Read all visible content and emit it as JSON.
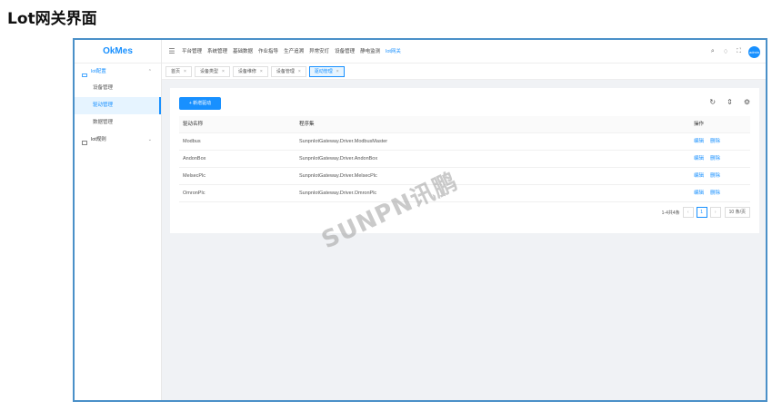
{
  "page_heading": "Lot网关界面",
  "app": {
    "logo": "OkMes"
  },
  "sidebar": {
    "groups": [
      {
        "label": "lot配置",
        "items": [
          "设备管理",
          "驱动管理",
          "数据管理"
        ]
      },
      {
        "label": "lot规则",
        "items": []
      }
    ],
    "active_item": "驱动管理"
  },
  "topnav": {
    "items": [
      "平台管理",
      "系统管理",
      "基础数据",
      "作业指导",
      "生产追溯",
      "异常安灯",
      "设备管理",
      "静电监测",
      "lot网关"
    ],
    "active": "lot网关",
    "avatar_text": "admin"
  },
  "tabs": [
    {
      "label": "首页",
      "active": false
    },
    {
      "label": "设备类型",
      "active": false
    },
    {
      "label": "设备维修",
      "active": false
    },
    {
      "label": "设备管理",
      "active": false
    },
    {
      "label": "驱动管理",
      "active": true
    }
  ],
  "toolbar": {
    "add_label": "+ 新增驱动"
  },
  "table": {
    "headers": [
      "驱动名称",
      "程序集",
      "操作"
    ],
    "rows": [
      {
        "name": "Modbus",
        "assembly": "SunpnIotGateway.Driver.ModbusMaster"
      },
      {
        "name": "AndonBox",
        "assembly": "SunpnIotGateway.Driver.AndonBox"
      },
      {
        "name": "MelsecPlc",
        "assembly": "SunpnIotGateway.Driver.MelsecPlc"
      },
      {
        "name": "OmronPlc",
        "assembly": "SunpnIotGateway.Driver.OmronPlc"
      }
    ],
    "op_edit": "编辑",
    "op_delete": "删除"
  },
  "pagination": {
    "summary": "1-4共4条",
    "current_page": "1",
    "page_size": "10 条/页"
  },
  "watermark": "SUNPN讯鹏",
  "colors": {
    "accent": "#1890ff",
    "frame_border": "#4a90c8"
  }
}
